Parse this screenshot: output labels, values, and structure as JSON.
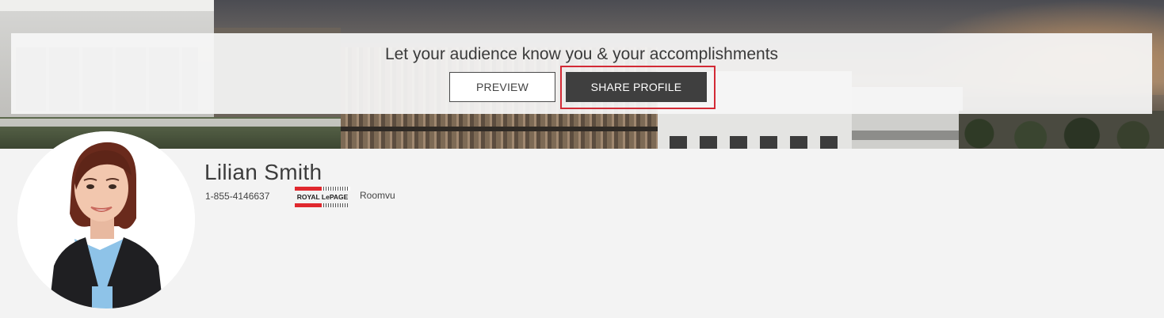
{
  "banner": {
    "headline": "Let your audience know you & your accomplishments",
    "buttons": {
      "preview_label": "PREVIEW",
      "share_label": "SHARE PROFILE"
    }
  },
  "profile": {
    "name": "Lilian Smith",
    "phone": "1-855-4146637",
    "brokerage_logo_text": "ROYAL LePAGE",
    "brokerage_name": "Roomvu"
  },
  "colors": {
    "share_button_bg": "#3f3f3f",
    "highlight_border": "#d32a35",
    "page_bg": "#f3f3f3"
  },
  "icons": {
    "brokerage_logo": "royal-lepage-logo",
    "avatar": "profile-photo"
  }
}
